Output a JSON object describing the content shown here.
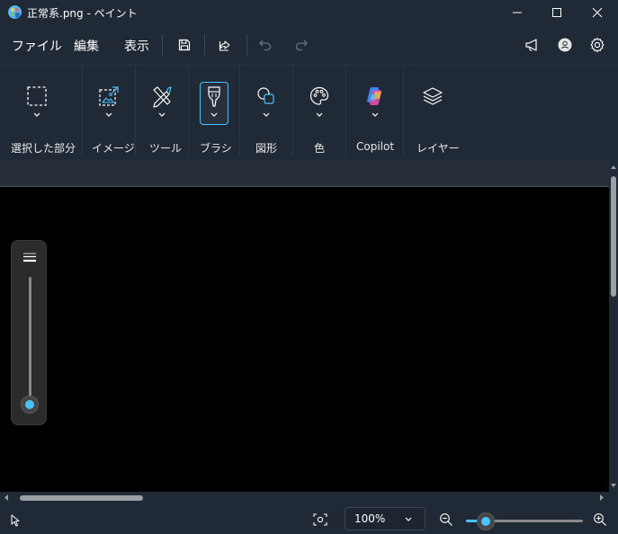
{
  "window": {
    "title": "正常系.png - ペイント"
  },
  "menu": {
    "file": "ファイル",
    "edit": "編集",
    "view": "表示"
  },
  "ribbon": {
    "selection": "選択した部分",
    "image": "イメージ",
    "tools": "ツール",
    "brushes": "ブラシ",
    "shapes": "図形",
    "color": "色",
    "copilot": "Copilot",
    "layers": "レイヤー"
  },
  "status": {
    "zoom_level": "100%",
    "zoom_slider_fraction": 0.18,
    "brush_size_fraction": 0.0
  },
  "colors": {
    "accent": "#4cc2ff",
    "chrome": "#202a36",
    "canvas": "#000000"
  }
}
